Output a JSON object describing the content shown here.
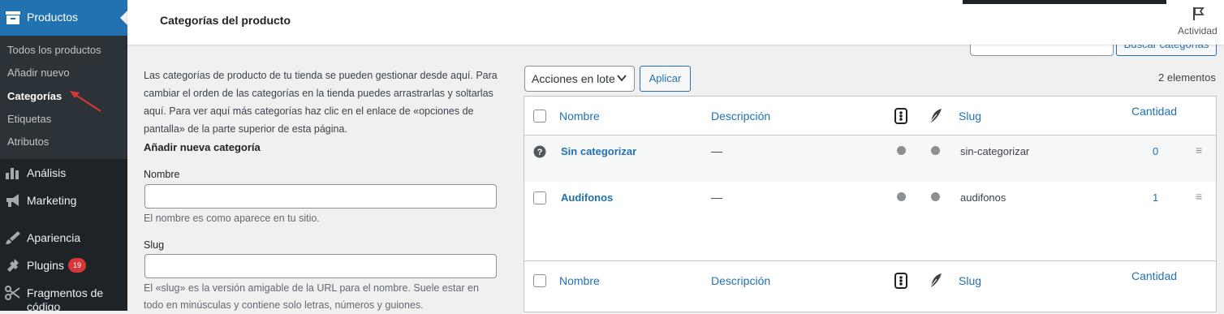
{
  "sidebar": {
    "active_menu": "Productos",
    "submenu": [
      "Todos los productos",
      "Añadir nuevo",
      "Categorías",
      "Etiquetas",
      "Atributos"
    ],
    "menu": {
      "analisis": "Análisis",
      "marketing": "Marketing",
      "apariencia": "Apariencia",
      "plugins": "Plugins",
      "plugins_badge": "19",
      "fragmentos_1": "Fragmentos de",
      "fragmentos_2": "código"
    }
  },
  "header": {
    "title": "Categorías del producto",
    "activity": "Actividad"
  },
  "search": {
    "button": "Buscar categorías"
  },
  "form": {
    "description": "Las categorías de producto de tu tienda se pueden gestionar desde aquí. Para cambiar el orden de las categorías en la tienda puedes arrastrarlas y soltarlas aquí. Para ver aquí más categorías haz clic en el enlace de «opciones de pantalla» de la parte superior de esta página.",
    "heading": "Añadir nueva categoría",
    "name_label": "Nombre",
    "name_help": "El nombre es como aparece en tu sitio.",
    "slug_label": "Slug",
    "slug_help": "El «slug» es la versión amigable de la URL para el nombre. Suele estar en todo en minúsculas y contiene solo letras, números y guiones."
  },
  "toolbar": {
    "bulk_actions": "Acciones en lote",
    "apply": "Aplicar",
    "count": "2 elementos"
  },
  "table": {
    "columns": {
      "name": "Nombre",
      "description": "Descripción",
      "slug": "Slug",
      "count": "Cantidad"
    },
    "rows": [
      {
        "name": "Sin categorizar",
        "description": "—",
        "slug": "sin-categorizar",
        "count": "0"
      },
      {
        "name": "Audifonos",
        "description": "—",
        "slug": "audifonos",
        "count": "1"
      }
    ]
  },
  "colors": {
    "sidebar_bg": "#1d2327",
    "accent": "#2271b1",
    "badge": "#d63638",
    "annotation_arrow": "#d63638"
  }
}
